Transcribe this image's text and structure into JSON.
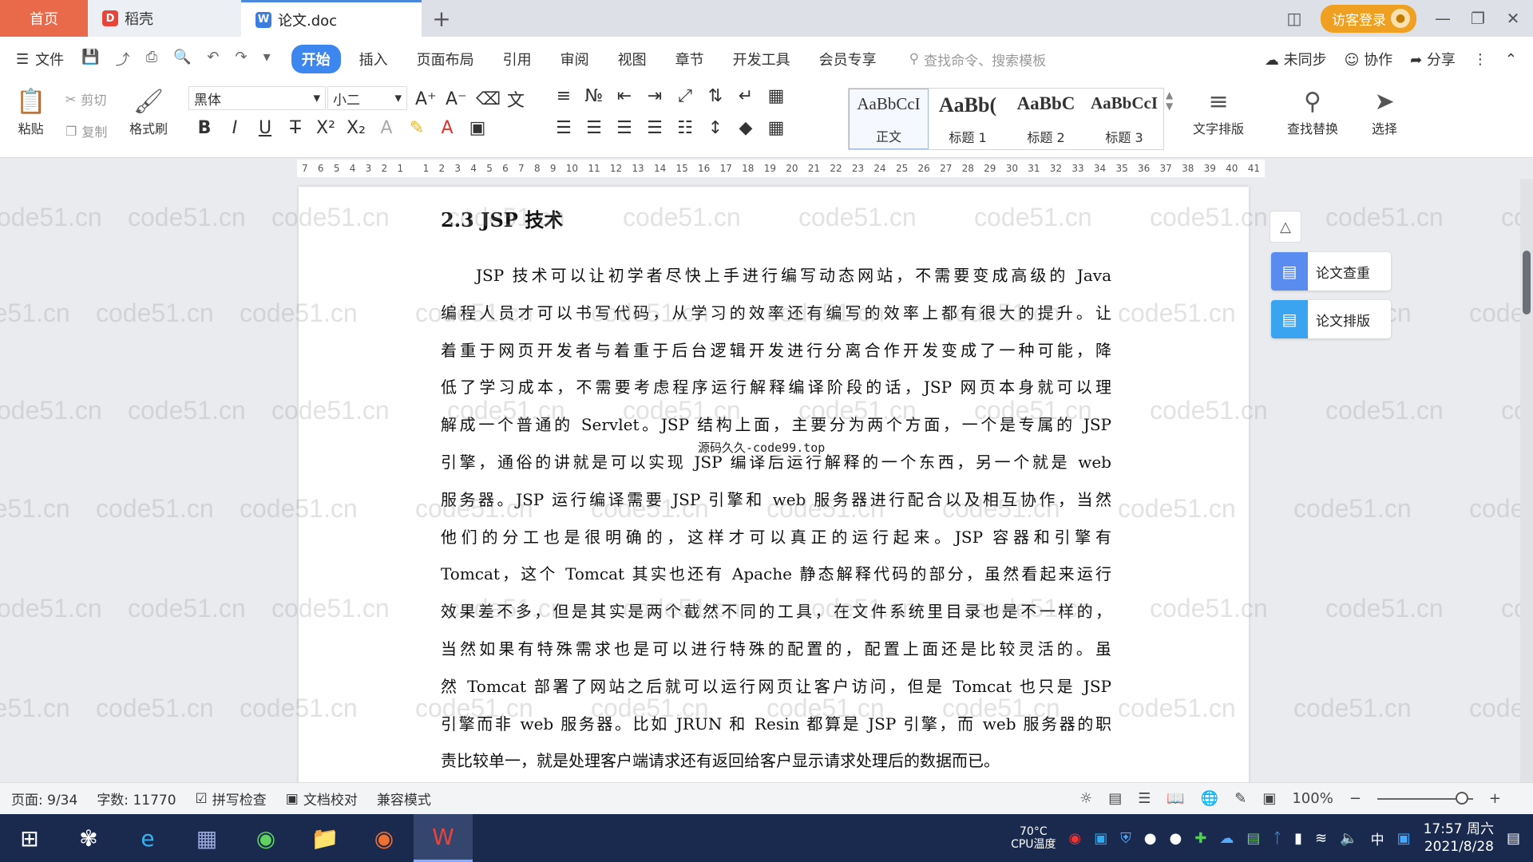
{
  "titlebar": {
    "tabs": [
      {
        "label": "首页"
      },
      {
        "label": "稻壳",
        "logo": "D"
      },
      {
        "label": "论文.doc",
        "logo": "W"
      }
    ],
    "add_tab": "+",
    "visitor_login": "访客登录"
  },
  "menubar": {
    "file": "文件",
    "items": [
      "开始",
      "插入",
      "页面布局",
      "引用",
      "审阅",
      "视图",
      "章节",
      "开发工具",
      "会员专享"
    ],
    "search_placeholder": "查找命令、搜索模板",
    "right": [
      "未同步",
      "协作",
      "分享"
    ]
  },
  "ribbon": {
    "paste": "粘贴",
    "cut": "剪切",
    "copy": "复制",
    "format_painter": "格式刷",
    "font_name": "黑体",
    "font_size": "小二",
    "styles": [
      {
        "preview": "AaBbCcI",
        "label": "正文"
      },
      {
        "preview": "AaBb(",
        "label": "标题 1"
      },
      {
        "preview": "AaBbC",
        "label": "标题 2"
      },
      {
        "preview": "AaBbCcI",
        "label": "标题 3"
      }
    ],
    "text_layout": "文字排版",
    "find_replace": "查找替换",
    "select": "选择"
  },
  "ruler": {
    "ticks": [
      "7",
      "6",
      "5",
      "4",
      "3",
      "2",
      "1",
      "",
      "1",
      "2",
      "3",
      "4",
      "5",
      "6",
      "7",
      "8",
      "9",
      "10",
      "11",
      "12",
      "13",
      "14",
      "15",
      "16",
      "17",
      "18",
      "19",
      "20",
      "21",
      "22",
      "23",
      "24",
      "25",
      "26",
      "27",
      "28",
      "29",
      "30",
      "31",
      "32",
      "33",
      "34",
      "35",
      "36",
      "37",
      "38",
      "39",
      "40",
      "41"
    ]
  },
  "document": {
    "heading": "2.3 JSP 技术",
    "lines": [
      "JSP 技术可以让初学者尽快上手进行编写动态网站，不需要变成高级的 Java",
      "编程人员才可以书写代码，从学习的效率还有编写的效率上都有很大的提升。让",
      "着重于网页开发者与着重于后台逻辑开发进行分离合作开发变成了一种可能，降",
      "低了学习成本，不需要考虑程序运行解释编译阶段的话，JSP 网页本身就可以理",
      "解成一个普通的 Servlet。JSP 结构上面，主要分为两个方面，一个是专属的 JSP",
      "引擎，通俗的讲就是可以实现 JSP 编译后运行解释的一个东西，另一个就是 web",
      "服务器。JSP 运行编译需要 JSP 引擎和 web 服务器进行配合以及相互协作，当然",
      "他们的分工也是很明确的，这样才可以真正的运行起来。JSP 容器和引擎有",
      "Tomcat，这个 Tomcat 其实也还有 Apache 静态解释代码的部分，虽然看起来运行",
      "效果差不多，但是其实是两个截然不同的工具，在文件系统里目录也是不一样的，",
      "当然如果有特殊需求也是可以进行特殊的配置的，配置上面还是比较灵活的。虽",
      "然 Tomcat 部署了网站之后就可以运行网页让客户访问，但是 Tomcat 也只是 JSP",
      "引擎而非 web 服务器。比如 JRUN 和 Resin 都算是 JSP 引擎，而 web 服务器的职",
      "责比较单一，就是处理客户端请求还有返回给客户显示请求处理后的数据而已。"
    ],
    "overlay_source": "源码久久-code99.top",
    "watermark": "code51.cn"
  },
  "side_panel": {
    "check": "论文查重",
    "layout": "论文排版"
  },
  "statusbar": {
    "page": "页面: 9/34",
    "words": "字数: 11770",
    "spellcheck": "拼写检查",
    "proofread": "文档校对",
    "compat": "兼容模式",
    "zoom": "100%"
  },
  "taskbar": {
    "cpu_temp": "70°C",
    "cpu_label": "CPU温度",
    "ime": "中",
    "time": "17:57 周六",
    "date": "2021/8/28"
  }
}
